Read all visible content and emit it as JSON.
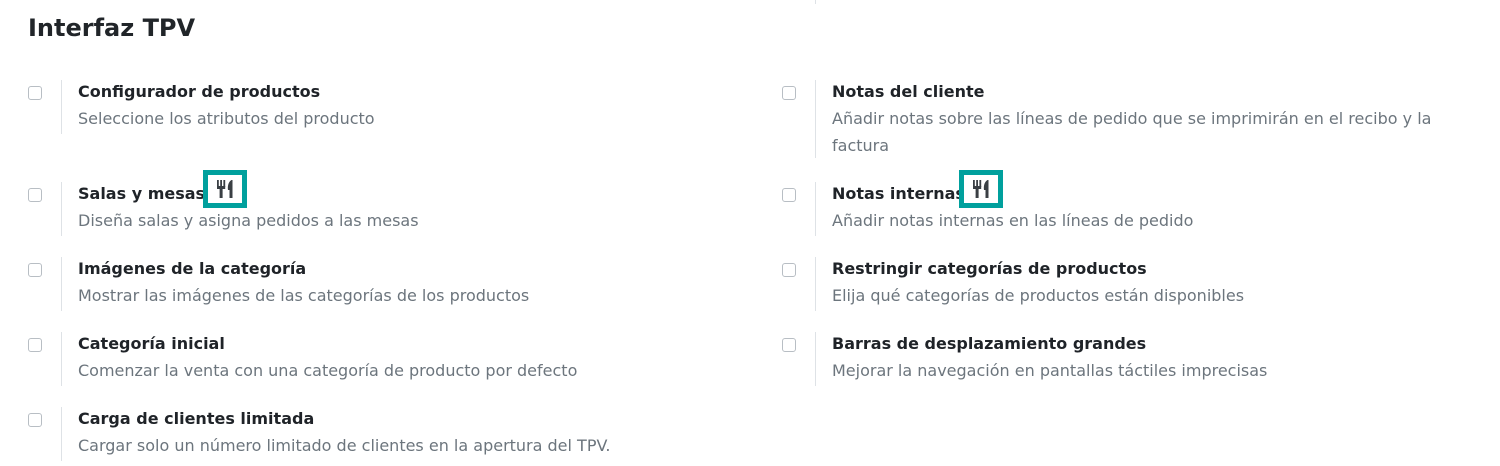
{
  "section": {
    "title": "Interfaz TPV"
  },
  "settings": {
    "product_configurator": {
      "label": "Configurador de productos",
      "description": "Seleccione los atributos del producto",
      "checked": false
    },
    "customer_notes": {
      "label": "Notas del cliente",
      "description": "Añadir notas sobre las líneas de pedido que se imprimirán en el recibo y la factura",
      "checked": false
    },
    "floors_tables": {
      "label": "Salas y mesas",
      "description": "Diseña salas y asigna pedidos a las mesas",
      "checked": false,
      "badge_icon": "restaurant-icon"
    },
    "internal_notes": {
      "label": "Notas internas",
      "description": "Añadir notas internas en las líneas de pedido",
      "checked": false,
      "badge_icon": "restaurant-icon"
    },
    "category_images": {
      "label": "Imágenes de la categoría",
      "description": "Mostrar las imágenes de las categorías de los productos",
      "checked": false
    },
    "restrict_categories": {
      "label": "Restringir categorías de productos",
      "description": "Elija qué categorías de productos están disponibles",
      "checked": false
    },
    "start_category": {
      "label": "Categoría inicial",
      "description": "Comenzar la venta con una categoría de producto por defecto",
      "checked": false
    },
    "large_scrollbars": {
      "label": "Barras de desplazamiento grandes",
      "description": "Mejorar la navegación en pantallas táctiles imprecisas",
      "checked": false
    },
    "limited_partners": {
      "label": "Carga de clientes limitada",
      "description": "Cargar solo un número limitado de clientes en la apertura del TPV.",
      "checked": false
    }
  },
  "colors": {
    "badge": "#00a09d",
    "label": "#1f2328",
    "description": "#6c757d",
    "divider": "#dee2e6"
  }
}
